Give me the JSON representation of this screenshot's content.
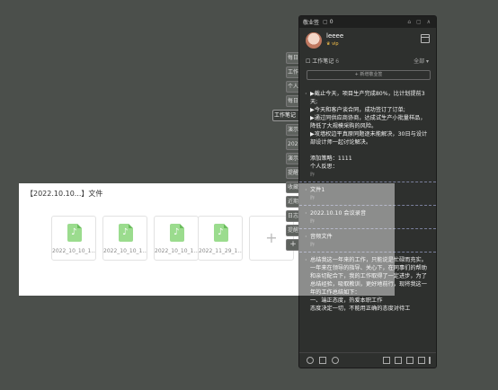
{
  "file_card": {
    "title": "【2022.10.10...】文件",
    "files": [
      {
        "name": "2022_10_10_1..."
      },
      {
        "name": "2022_10_10_1..."
      },
      {
        "name": "2022_10_10_1..."
      },
      {
        "name": "2022_11_29_1..."
      }
    ],
    "add_label": "+"
  },
  "side_tabs": [
    "每日",
    "工作",
    "个人",
    "每日",
    "工作笔记",
    "演示",
    "2022",
    "演示",
    "提醒",
    "收藏",
    "近期",
    "日志",
    "提醒",
    "近期",
    "+"
  ],
  "panel": {
    "app_name": "敬业签",
    "notif_count": "0",
    "user": {
      "name": "leeee",
      "badge": "♛ vip"
    },
    "section_label": "工作笔记",
    "section_count": "6",
    "section_filter": "全部",
    "new_button": "+ 新增敬业签",
    "notes": [
      {
        "text": "▶截止今天，项目生产完成80%，比计划提前3天;\n▶今天和客户谈合同，成功签订了订单;\n▶通过同供应商协商，达成试生产小批量样品，降低了大规模采购的风险。\n▶攻墙权边平真原同题逐未能解决，30日与设计部设计师一起讨论解决。\n\n添加策略：1111\n个人反思：",
        "meta": "昨"
      },
      {
        "text": "文件1",
        "meta": "昨"
      },
      {
        "text": "2022.10.10 会议录音",
        "meta": "昨"
      },
      {
        "text": "音频文件",
        "meta": "昨"
      },
      {
        "text": "总结我这一年来的工作，只能说是忙碌而充实。一年来在领导的指导、关心下，在同事们的帮助和亲切配合下，我的工作取得了一定进步，为了总结经验，吸取教训，更好地前行，现将我这一年的工作总结如下：\n一、端正态度，热爱本职工作\n态度决定一切，不能用正确的态度对待工",
        "meta": ""
      }
    ]
  }
}
